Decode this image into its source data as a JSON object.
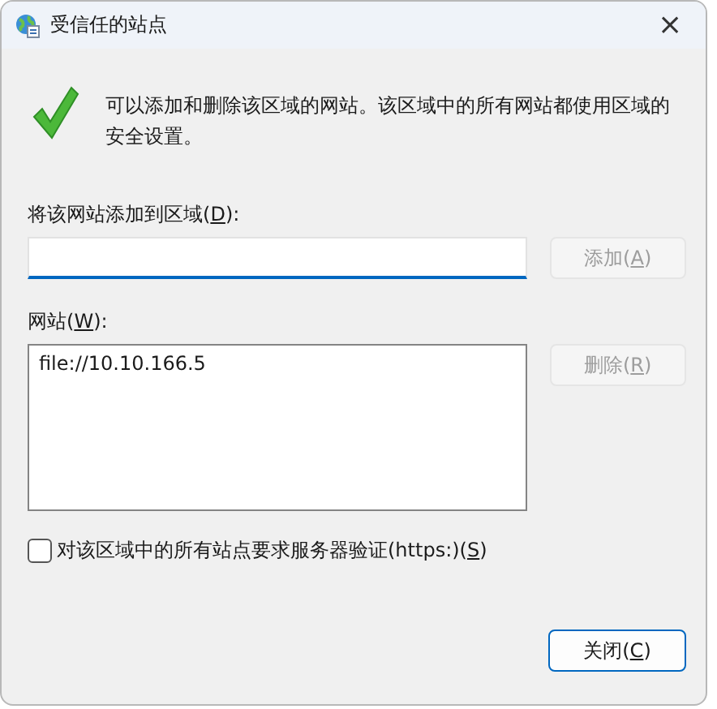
{
  "window": {
    "title": "受信任的站点",
    "close": "×"
  },
  "description": "可以添加和删除该区域的网站。该区域中的所有网站都使用区域的安全设置。",
  "add_field": {
    "label": {
      "text": "将该网站添加到区域(",
      "key": "D",
      "after": "):"
    }
  },
  "add_button": {
    "text": "添加(",
    "key": "A",
    "after": ")",
    "disabled": true
  },
  "sites": {
    "label": {
      "text": "网站(",
      "key": "W",
      "after": "):"
    },
    "items": [
      {
        "text": "file://10.10.166.5",
        "selected": false
      }
    ]
  },
  "remove_button": {
    "text": "删除(",
    "key": "R",
    "after": ")",
    "disabled": true
  },
  "https_checkbox": {
    "text": "对该区域中的所有站点要求服务器验证(https:)(",
    "key": "S",
    "after": ")",
    "checked": false
  },
  "close_button": {
    "text": "关闭(",
    "key": "C",
    "after": ")",
    "disabled": false
  }
}
